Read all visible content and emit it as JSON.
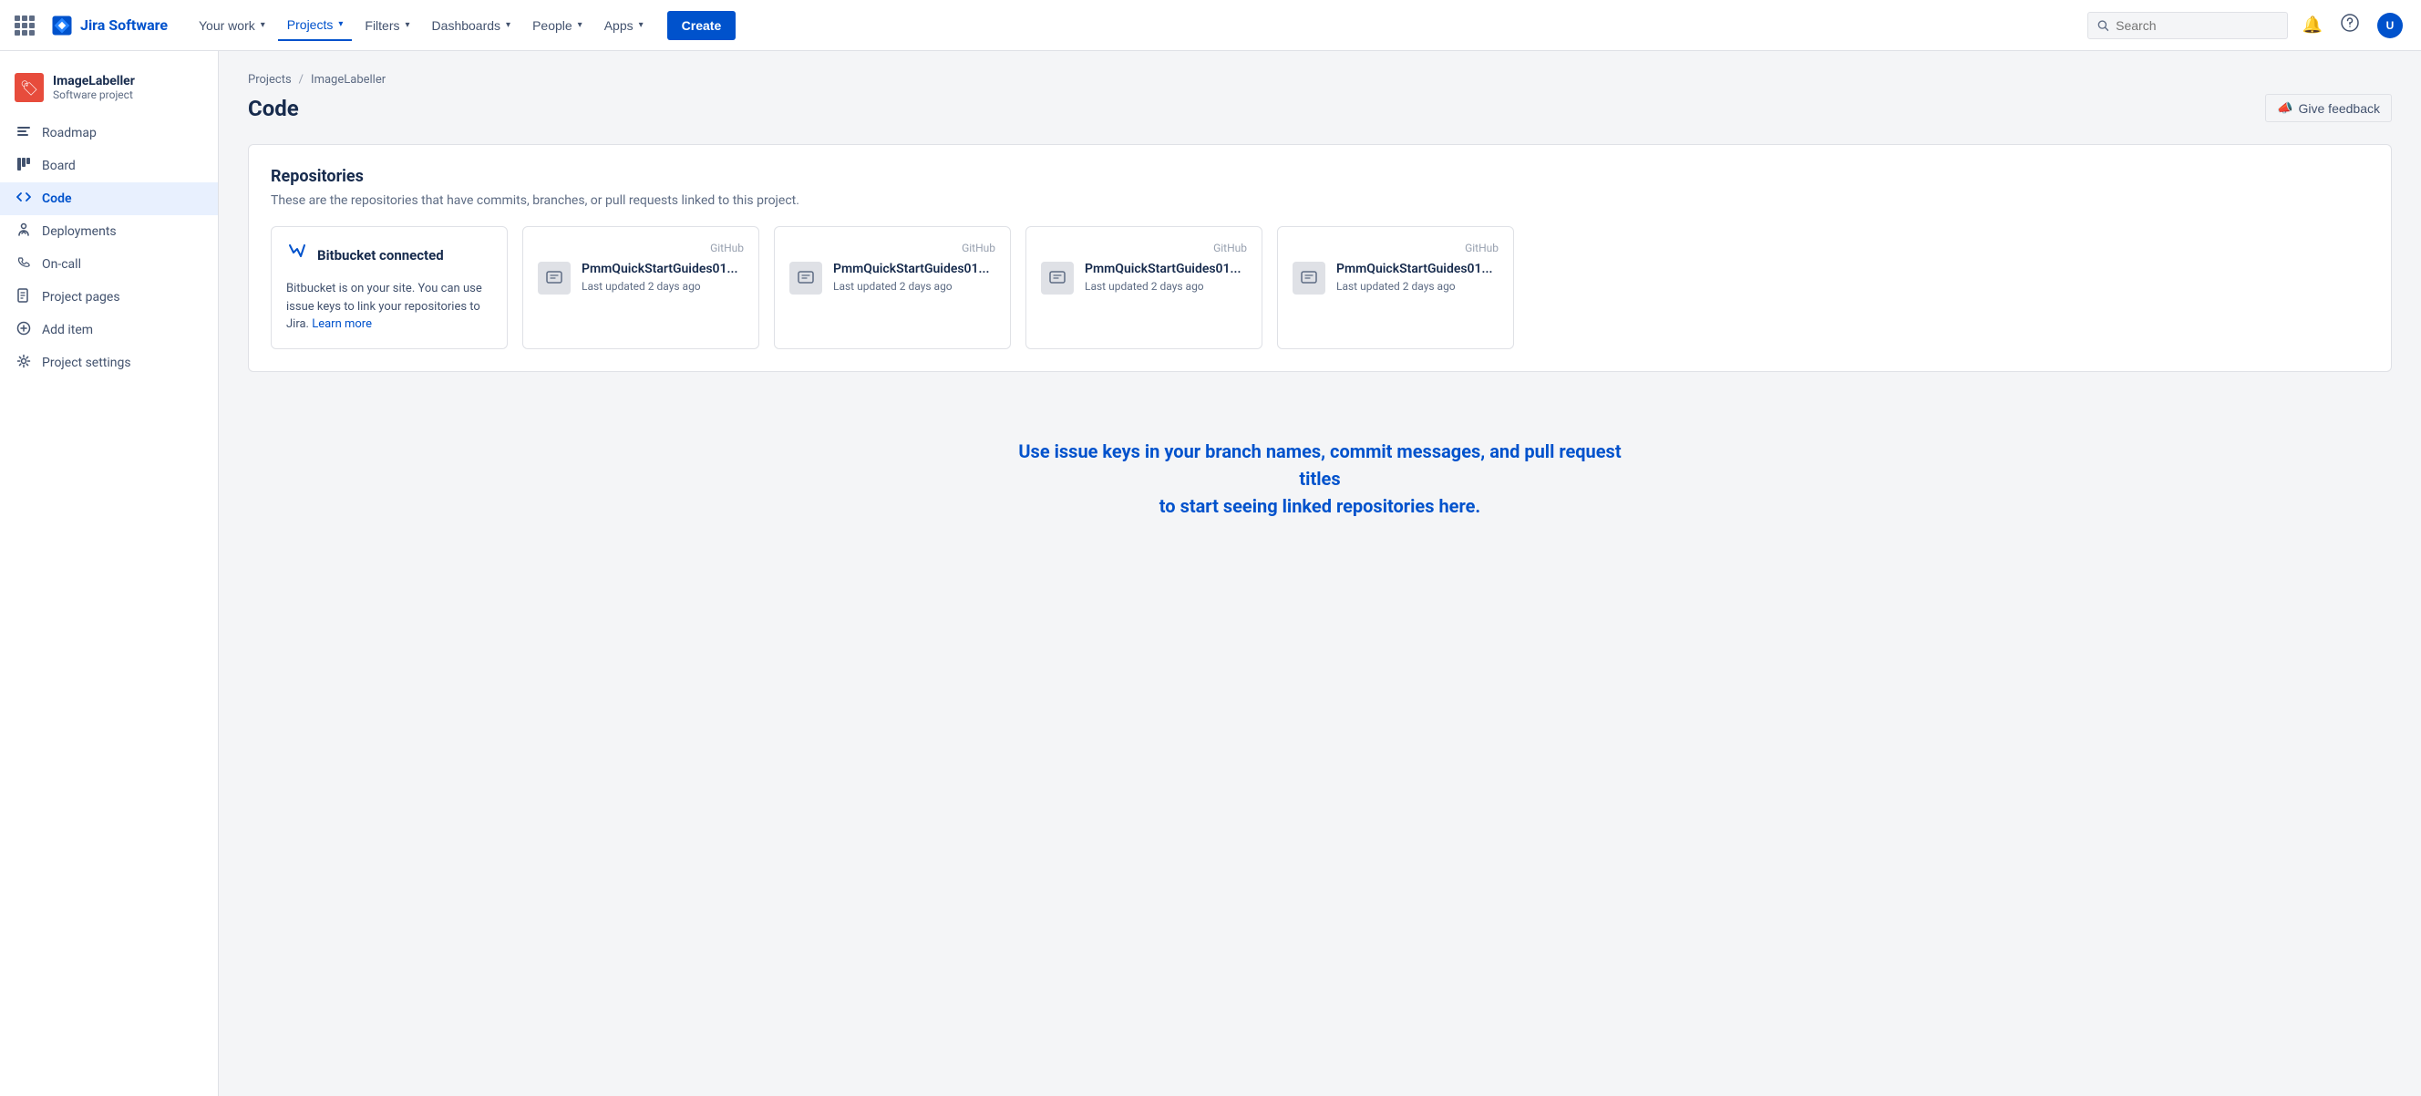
{
  "topnav": {
    "logo_text": "Jira Software",
    "nav_items": [
      {
        "id": "your-work",
        "label": "Your work",
        "chevron": true,
        "active": false
      },
      {
        "id": "projects",
        "label": "Projects",
        "chevron": true,
        "active": true
      },
      {
        "id": "filters",
        "label": "Filters",
        "chevron": true,
        "active": false
      },
      {
        "id": "dashboards",
        "label": "Dashboards",
        "chevron": true,
        "active": false
      },
      {
        "id": "people",
        "label": "People",
        "chevron": true,
        "active": false
      },
      {
        "id": "apps",
        "label": "Apps",
        "chevron": true,
        "active": false
      }
    ],
    "create_label": "Create",
    "search_placeholder": "Search"
  },
  "sidebar": {
    "project_name": "ImageLabeller",
    "project_type": "Software project",
    "items": [
      {
        "id": "roadmap",
        "label": "Roadmap",
        "icon": "📋",
        "active": false
      },
      {
        "id": "board",
        "label": "Board",
        "icon": "▦",
        "active": false
      },
      {
        "id": "code",
        "label": "Code",
        "icon": "</>",
        "active": true
      },
      {
        "id": "deployments",
        "label": "Deployments",
        "icon": "🚀",
        "active": false
      },
      {
        "id": "on-call",
        "label": "On-call",
        "icon": "📞",
        "active": false
      },
      {
        "id": "project-pages",
        "label": "Project pages",
        "icon": "📄",
        "active": false
      },
      {
        "id": "add-item",
        "label": "Add item",
        "icon": "+",
        "active": false
      },
      {
        "id": "project-settings",
        "label": "Project settings",
        "icon": "⚙",
        "active": false
      }
    ]
  },
  "breadcrumb": {
    "items": [
      "Projects",
      "ImageLabeller"
    ]
  },
  "page": {
    "title": "Code",
    "feedback_label": "Give feedback"
  },
  "repositories": {
    "title": "Repositories",
    "description": "These are the repositories that have commits, branches, or pull requests linked to this project.",
    "bitbucket_card": {
      "title": "Bitbucket connected",
      "description": "Bitbucket is on your site. You can use issue keys to link your repositories to Jira.",
      "learn_more": "Learn more"
    },
    "cards": [
      {
        "id": "repo1",
        "provider": "GitHub",
        "name": "PmmQuickStartGuides01...",
        "updated": "Last updated 2 days ago"
      },
      {
        "id": "repo2",
        "provider": "GitHub",
        "name": "PmmQuickStartGuides01...",
        "updated": "Last updated 2 days ago"
      },
      {
        "id": "repo3",
        "provider": "GitHub",
        "name": "PmmQuickStartGuides01...",
        "updated": "Last updated 2 days ago"
      },
      {
        "id": "repo4",
        "provider": "GitHub",
        "name": "PmmQuickStartGuides01...",
        "updated": "Last updated 2 days ago"
      }
    ]
  },
  "bottom_banner": {
    "line1": "Use issue keys in your branch names, commit messages, and pull request titles",
    "line2": "to start seeing linked repositories here."
  }
}
